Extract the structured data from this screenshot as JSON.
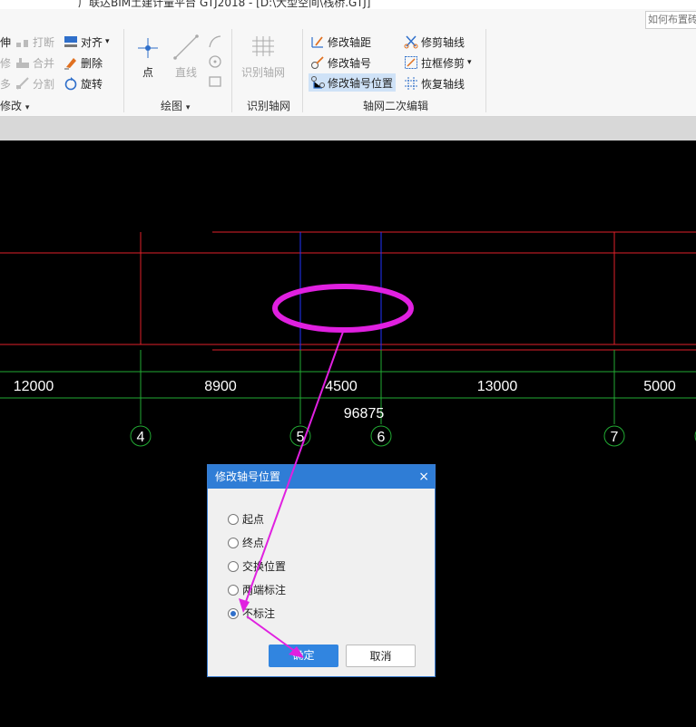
{
  "window": {
    "title": "广联达BIM土建计量平台 GTJ2018 - [D:\\大型空间\\栈桥.GTJ]",
    "search_placeholder": "如何布置砖"
  },
  "ribbon": {
    "modify": {
      "stretch": "伸",
      "break": "打断",
      "align": "对齐",
      "align_arrow": "▾",
      "repair": "修",
      "merge": "合并",
      "delete": "删除",
      "multi": "多",
      "split": "分割",
      "rotate": "旋转",
      "group_label": "修改",
      "group_arrow": "▾"
    },
    "draw": {
      "point": "点",
      "line": "直线",
      "group_label": "绘图",
      "group_arrow": "▾"
    },
    "identify": {
      "identify_axis": "识别轴网",
      "group_label": "识别轴网"
    },
    "axis_edit": {
      "modify_spacing": "修改轴距",
      "trim_axis": "修剪轴线",
      "modify_number": "修改轴号",
      "box_trim": "拉框修剪",
      "box_trim_arrow": "▾",
      "modify_number_position": "修改轴号位置",
      "restore_axis": "恢复轴线",
      "group_label": "轴网二次编辑"
    }
  },
  "canvas": {
    "dimensions": [
      "12000",
      "8900",
      "4500",
      "13000",
      "5000"
    ],
    "total": "96875",
    "axis_labels": [
      "4",
      "5",
      "6",
      "7"
    ],
    "colors": {
      "grid_red": "#e0202a",
      "dim_green": "#22aa33",
      "axis_blue": "#2233ff",
      "highlight": "#e020e0"
    }
  },
  "dialog": {
    "title": "修改轴号位置",
    "close": "×",
    "options": [
      {
        "label": "起点",
        "selected": false
      },
      {
        "label": "终点",
        "selected": false
      },
      {
        "label": "交换位置",
        "selected": false
      },
      {
        "label": "两端标注",
        "selected": false
      },
      {
        "label": "不标注",
        "selected": true
      }
    ],
    "ok": "确定",
    "cancel": "取消"
  }
}
